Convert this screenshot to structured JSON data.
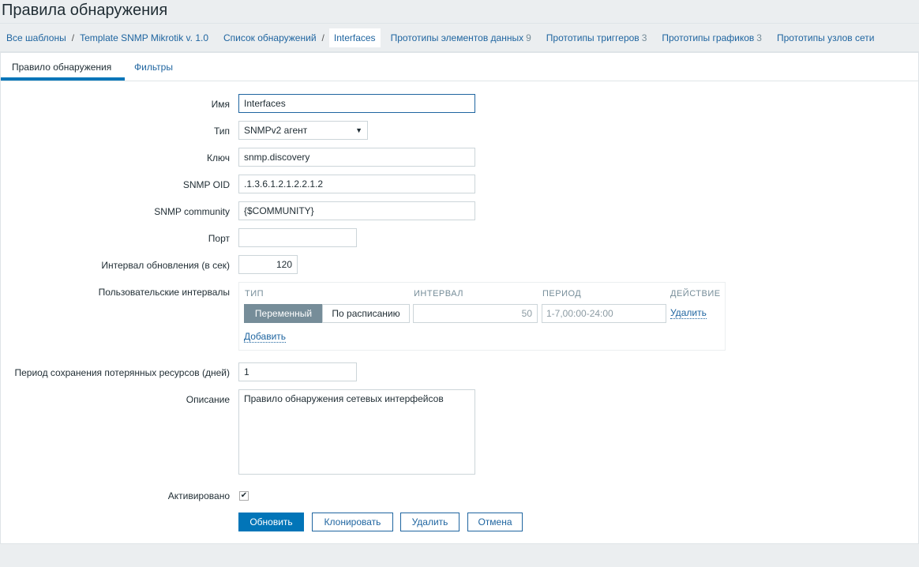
{
  "page_title": "Правила обнаружения",
  "breadcrumbs": {
    "all_templates": "Все шаблоны",
    "template": "Template SNMP Mikrotik v. 1.0",
    "discovery_list": "Список обнаружений",
    "current": "Interfaces",
    "item_prototypes": "Прототипы элементов данных",
    "item_prototypes_count": "9",
    "trigger_prototypes": "Прототипы триггеров",
    "trigger_prototypes_count": "3",
    "graph_prototypes": "Прототипы графиков",
    "graph_prototypes_count": "3",
    "host_prototypes": "Прототипы узлов сети"
  },
  "tabs": [
    "Правило обнаружения",
    "Фильтры"
  ],
  "form": {
    "name_label": "Имя",
    "name_value": "Interfaces",
    "type_label": "Тип",
    "type_value": "SNMPv2 агент",
    "key_label": "Ключ",
    "key_value": "snmp.discovery",
    "oid_label": "SNMP OID",
    "oid_value": ".1.3.6.1.2.1.2.2.1.2",
    "community_label": "SNMP community",
    "community_value": "{$COMMUNITY}",
    "port_label": "Порт",
    "port_value": "",
    "interval_label": "Интервал обновления (в сек)",
    "interval_value": "120",
    "custom_label": "Пользовательские интервалы",
    "custom": {
      "col_type": "ТИП",
      "col_interval": "ИНТЕРВАЛ",
      "col_period": "ПЕРИОД",
      "col_action": "ДЕЙСТВИЕ",
      "flexible": "Переменный",
      "scheduling": "По расписанию",
      "interval_placeholder": "50",
      "period_placeholder": "1-7,00:00-24:00",
      "remove": "Удалить",
      "add": "Добавить"
    },
    "lifetime_label": "Период сохранения потерянных ресурсов (дней)",
    "lifetime_value": "1",
    "description_label": "Описание",
    "description_value": "Правило обнаружения сетевых интерфейсов",
    "enabled_label": "Активировано",
    "enabled": true
  },
  "buttons": {
    "update": "Обновить",
    "clone": "Клонировать",
    "delete": "Удалить",
    "cancel": "Отмена"
  }
}
